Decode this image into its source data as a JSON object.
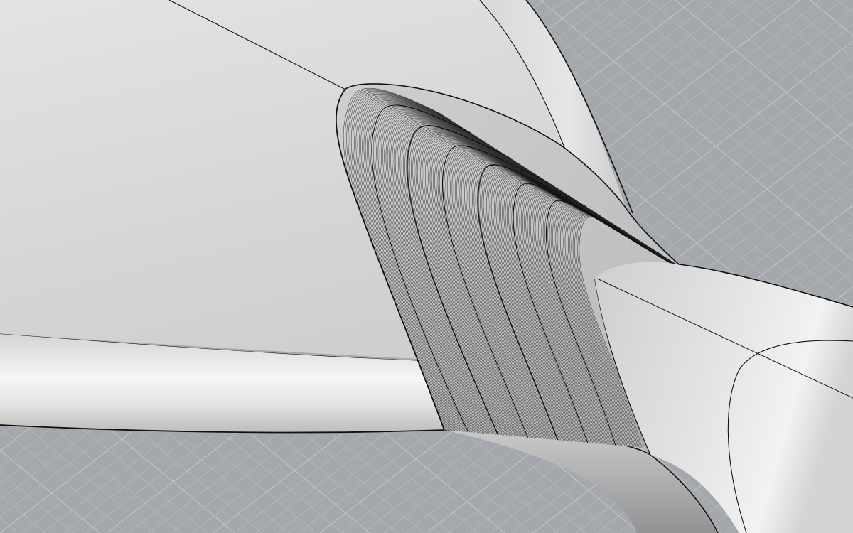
{
  "viewport": {
    "view_mode": "shaded",
    "grid_visible": true,
    "colors": {
      "background": "#a4a8ad",
      "grid_line": "#b6babf",
      "grid_major": "#c2c6ca",
      "surface_light": "#ececec",
      "surface_mid": "#d6d6d6",
      "surface_shadow": "#9a9a9a",
      "edge": "#111111"
    }
  },
  "model": {
    "objects": [
      {
        "name": "upper-dome-surface",
        "selected": false
      },
      {
        "name": "lower-lip-surface",
        "selected": false
      },
      {
        "name": "right-tube-surface",
        "selected": false
      },
      {
        "name": "blend-surface",
        "selected": false,
        "isocurve_density": "high"
      }
    ]
  }
}
